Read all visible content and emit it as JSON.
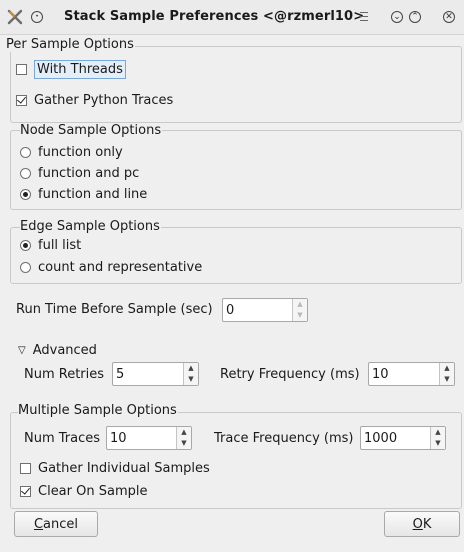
{
  "window": {
    "title": "Stack Sample Preferences <@rzmerl10>"
  },
  "per_sample": {
    "title": "Per Sample Options",
    "with_threads": {
      "label": "With Threads",
      "checked": false
    },
    "gather_python": {
      "label": "Gather Python Traces",
      "checked": true
    }
  },
  "node_sample": {
    "title": "Node Sample Options",
    "options": [
      "function only",
      "function and pc",
      "function and line"
    ],
    "selected": 2
  },
  "edge_sample": {
    "title": "Edge Sample Options",
    "options": [
      "full list",
      "count and representative"
    ],
    "selected": 0
  },
  "run_time": {
    "label": "Run Time Before Sample (sec)",
    "value": "0"
  },
  "advanced": {
    "label": "Advanced",
    "num_retries_label": "Num Retries",
    "num_retries": "5",
    "retry_freq_label": "Retry Frequency (ms)",
    "retry_freq": "10"
  },
  "multiple": {
    "title": "Multiple Sample Options",
    "num_traces_label": "Num Traces",
    "num_traces": "10",
    "trace_freq_label": "Trace Frequency (ms)",
    "trace_freq": "1000",
    "gather_individual": {
      "label": "Gather Individual Samples",
      "checked": false
    },
    "clear_on_sample": {
      "label": "Clear On Sample",
      "checked": true
    }
  },
  "buttons": {
    "cancel_first": "C",
    "cancel_rest": "ancel",
    "ok_first": "O",
    "ok_rest": "K"
  }
}
